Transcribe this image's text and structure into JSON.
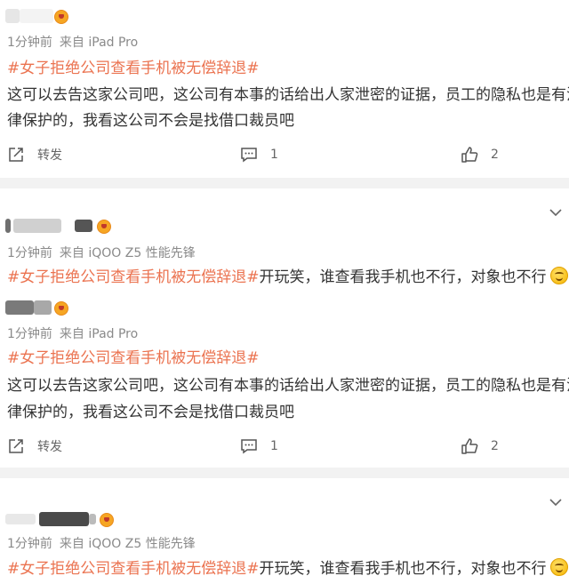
{
  "posts": [
    {
      "time": "1分钟前",
      "source": "来自 iPad Pro",
      "topic": "#女子拒绝公司查看手机被无偿辞退#",
      "lines": [
        "这可以去告这家公司吧，这公司有本事的话给出人家泄密的证据，员工的隐私也是有法",
        "律保护的，我看这公司不会是找借口裁员吧"
      ],
      "repost_label": "转发",
      "comment_count": "1",
      "like_count": "2"
    },
    {
      "time": "1分钟前",
      "source": "来自 iQOO Z5 性能先锋",
      "topic": "#女子拒绝公司查看手机被无偿辞退#",
      "text": "开玩笑，谁查看我手机也不行，对象也不行"
    },
    {
      "time": "1分钟前",
      "source": "来自 iPad Pro",
      "topic": "#女子拒绝公司查看手机被无偿辞退#",
      "lines": [
        "这可以去告这家公司吧，这公司有本事的话给出人家泄密的证据，员工的隐私也是有法",
        "律保护的，我看这公司不会是找借口裁员吧"
      ],
      "repost_label": "转发",
      "comment_count": "1",
      "like_count": "2"
    },
    {
      "time": "1分钟前",
      "source": "来自 iQOO Z5 性能先锋",
      "topic": "#女子拒绝公司查看手机被无偿辞退#",
      "text": "开玩笑，谁查看我手机也不行，对象也不行"
    }
  ],
  "icons": {
    "vip": "vip-crown-badge-icon",
    "repost": "repost-icon",
    "comment": "comment-icon",
    "like": "thumbs-up-icon",
    "expand": "chevron-down-icon",
    "emoji": "smile-emoji-icon"
  },
  "colors": {
    "topic": "#eb7350",
    "meta": "#8a8a8a",
    "text": "#333333",
    "divider": "#f2f2f2"
  }
}
